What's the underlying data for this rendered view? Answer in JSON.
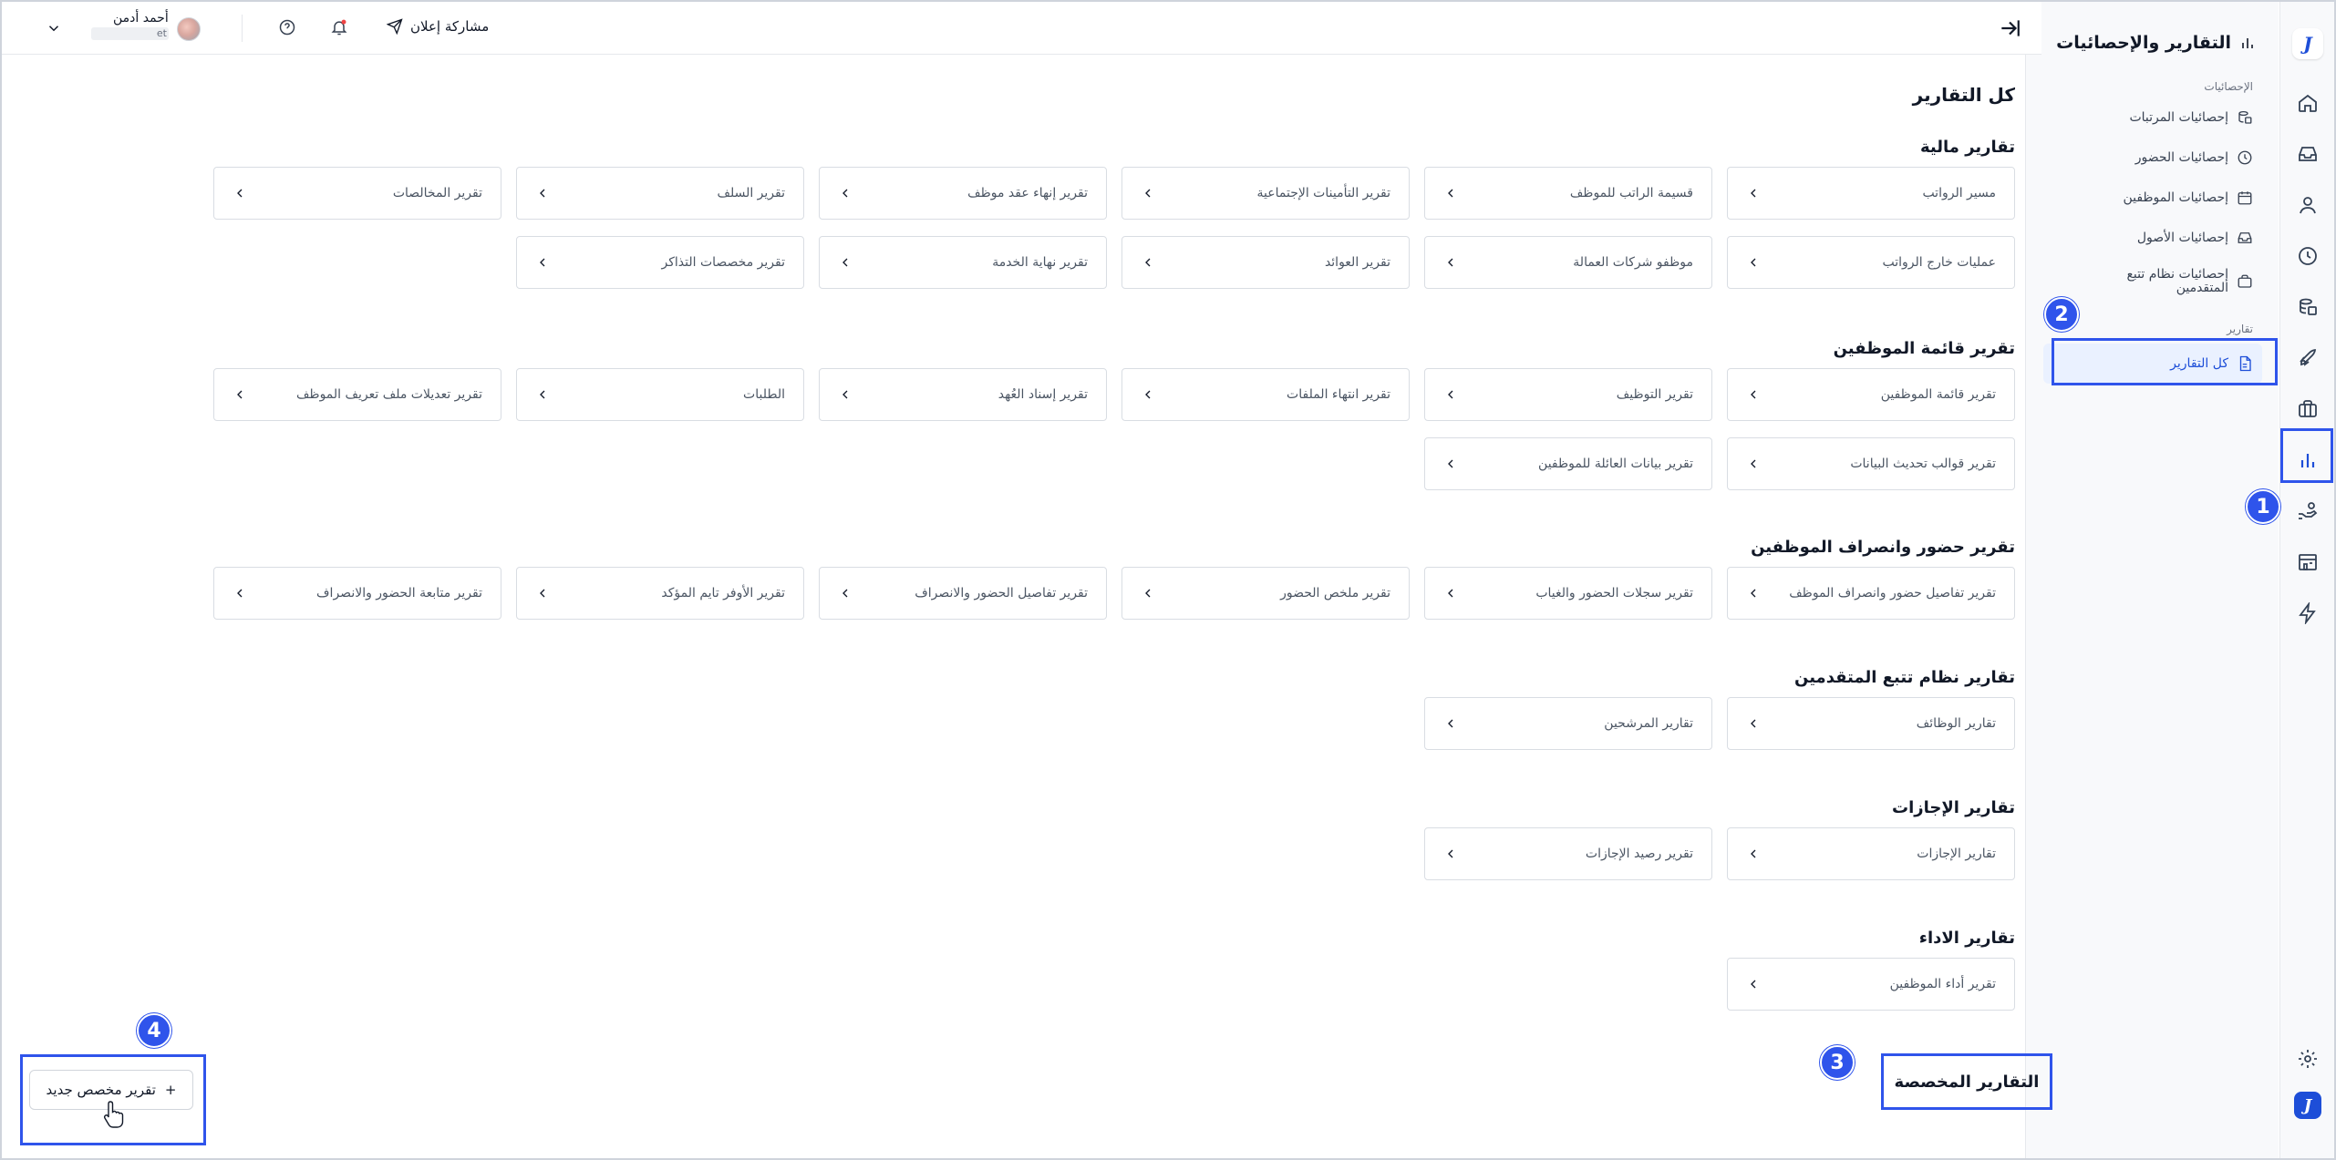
{
  "sidebar": {
    "title": "التقارير والإحصائيات",
    "stats_section": "الإحصائيات",
    "stats_items": [
      "إحصائيات المرتبات",
      "إحصائيات الحضور",
      "إحصائيات الموظفين",
      "إحصائيات الأصول",
      "إحصائيات نظام تتبع المتقدمين"
    ],
    "reports_section": "تقارير",
    "active_item": "كل التقارير"
  },
  "topbar": {
    "share_label": "مشاركة إعلان",
    "user_name": "أحمد أدمن",
    "user_sub": "et"
  },
  "main": {
    "page_title": "كل التقارير",
    "sections": [
      {
        "title": "تقارير مالية",
        "cards": [
          "مسير الرواتب",
          "قسيمة الراتب للموظف",
          "تقرير التأمينات الإجتماعية",
          "تقرير إنهاء عقد موظف",
          "تقرير السلف",
          "تقرير المخالصات",
          "عمليات خارج الرواتب",
          "موظفو شركات العمالة",
          "تقرير العوائد",
          "تقرير نهاية الخدمة",
          "تقرير مخصصات التذاكر"
        ]
      },
      {
        "title": "تقرير قائمة الموظفين",
        "cards": [
          "تقرير قائمة الموظفين",
          "تقرير التوظيف",
          "تقرير انتهاء الملفات",
          "تقرير إسناد العُهد",
          "الطلبات",
          "تقرير تعديلات ملف تعريف الموظف",
          "تقرير قوالب تحديث البيانات",
          "تقرير بيانات العائلة للموظفين"
        ]
      },
      {
        "title": "تقرير حضور وانصراف الموظفين",
        "cards": [
          "تقرير تفاصيل حضور وانصراف الموظف",
          "تقرير سجلات الحضور والغياب",
          "تقرير ملخص الحضور",
          "تقرير تفاصيل الحضور والانصراف",
          "تقرير الأوفر تايم المؤكد",
          "تقرير متابعة الحضور والانصراف"
        ]
      },
      {
        "title": "تقارير نظام تتبع المتقدمين",
        "cards": [
          "تقارير الوظائف",
          "تقارير المرشحين"
        ]
      },
      {
        "title": "تقارير الإجازات",
        "cards": [
          "تقارير الإجازات",
          "تقرير رصيد الإجازات"
        ]
      },
      {
        "title": "تقارير الاداء",
        "cards": [
          "تقرير أداء الموظفين"
        ]
      }
    ],
    "custom_reports_title": "التقارير المخصصة",
    "new_custom_report": "تقرير مخصص جديد",
    "new_custom_report_plus": "+"
  },
  "annotations": {
    "badges": [
      "1",
      "2",
      "3",
      "4"
    ],
    "color": "#2f54eb"
  },
  "colors": {
    "accent": "#1d4ed8",
    "highlight": "#2f54eb",
    "active_bg": "#eaf1ff"
  },
  "icons": {
    "rail": [
      "logo-icon",
      "home-icon",
      "inbox-icon",
      "user-icon",
      "clock-icon",
      "payroll-icon",
      "rocket-icon",
      "briefcase-icon",
      "chart-icon",
      "handshake-icon",
      "building-icon",
      "bolt-icon",
      "gear-icon",
      "logo-icon"
    ],
    "card_arrow": "chevron-left-icon"
  }
}
